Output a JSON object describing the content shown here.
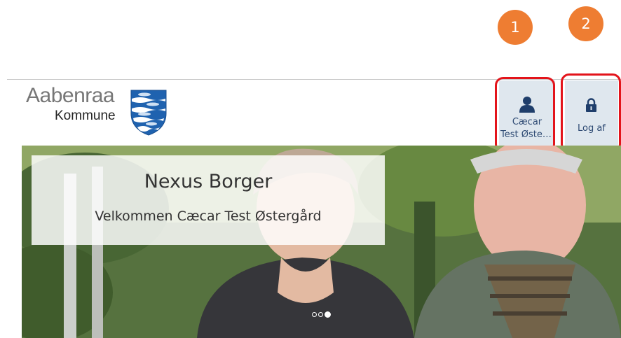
{
  "callouts": [
    "1",
    "2"
  ],
  "logo": {
    "line1": "Aabenraa",
    "line2": "Kommune"
  },
  "header": {
    "user_button": {
      "line1": "Cæcar",
      "line2": "Test Øster..."
    },
    "logout_button": {
      "label": "Log af"
    }
  },
  "hero": {
    "title": "Nexus Borger",
    "subtitle": "Velkommen Cæcar Test Østergård",
    "carousel_total": 3,
    "carousel_active": 3
  },
  "colors": {
    "callout": "#EE7D32",
    "highlight": "#E3141B",
    "button_bg": "#DFE7EE",
    "button_text": "#2E4A73",
    "shield_blue": "#1F62AF"
  },
  "icons": {
    "user": "user-icon",
    "logout": "lock-icon"
  }
}
